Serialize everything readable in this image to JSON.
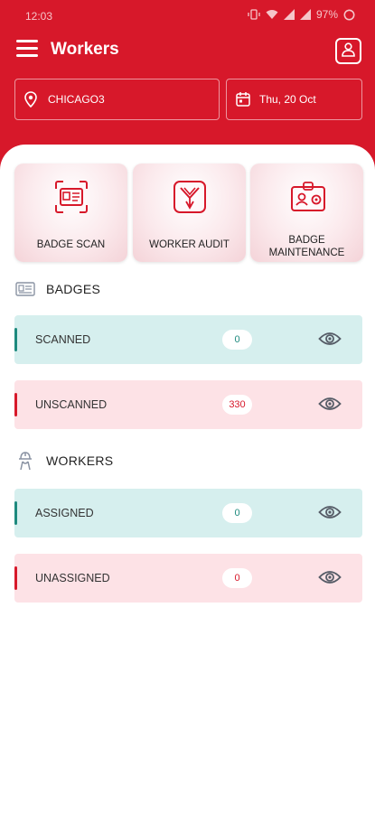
{
  "status_bar": {
    "time": "12:03",
    "battery": "97%"
  },
  "header": {
    "title": "Workers"
  },
  "filters": {
    "location": "CHICAGO3",
    "date": "Thu, 20 Oct"
  },
  "tiles": [
    {
      "label": "BADGE SCAN"
    },
    {
      "label": "WORKER AUDIT"
    },
    {
      "label_line1": "BADGE",
      "label_line2": "MAINTENANCE"
    }
  ],
  "badges": {
    "title": "BADGES",
    "rows": [
      {
        "label": "SCANNED",
        "count": "0"
      },
      {
        "label": "UNSCANNED",
        "count": "330"
      }
    ]
  },
  "workers": {
    "title": "WORKERS",
    "rows": [
      {
        "label": "ASSIGNED",
        "count": "0"
      },
      {
        "label": "UNASSIGNED",
        "count": "0"
      }
    ]
  },
  "colors": {
    "brand": "#d7182a",
    "teal": "#1e8a7e",
    "teal_bg": "#d6efee",
    "pink_bg": "#fde2e6"
  }
}
